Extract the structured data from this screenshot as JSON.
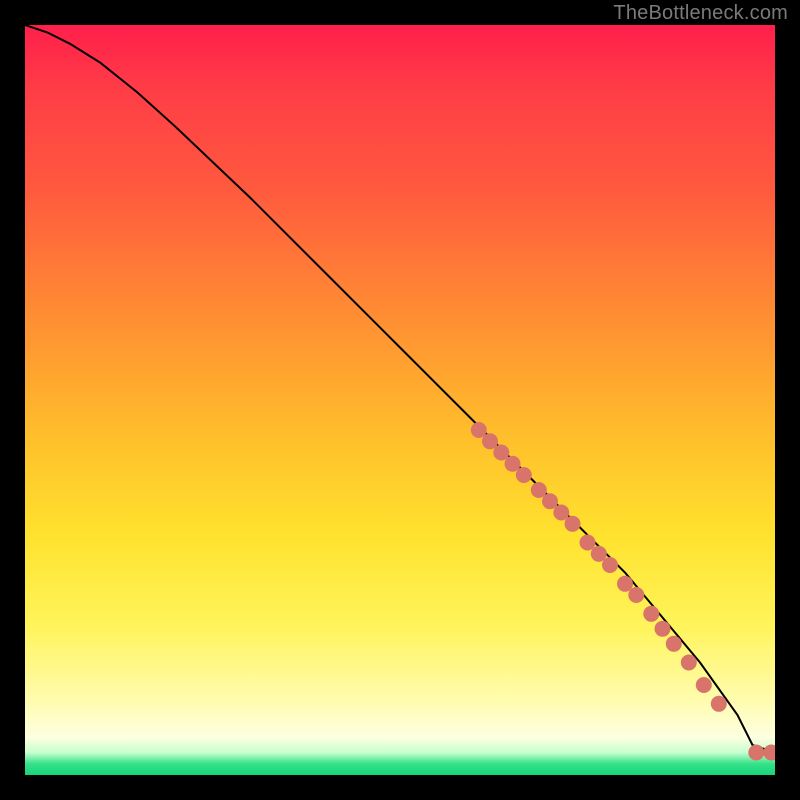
{
  "watermark": "TheBottleneck.com",
  "chart_data": {
    "type": "line",
    "title": "",
    "xlabel": "",
    "ylabel": "",
    "xlim": [
      0,
      100
    ],
    "ylim": [
      0,
      100
    ],
    "series": [
      {
        "name": "curve",
        "x": [
          0,
          3,
          6,
          10,
          15,
          20,
          30,
          40,
          50,
          60,
          70,
          80,
          90,
          95,
          97,
          100
        ],
        "y": [
          100,
          99,
          97.5,
          95,
          91,
          86.5,
          77,
          67,
          57,
          47,
          37,
          27,
          15,
          8,
          4,
          3
        ]
      }
    ],
    "scatter": {
      "name": "points",
      "color": "#d9746b",
      "radius": 8,
      "points": [
        {
          "x": 60.5,
          "y": 46.0
        },
        {
          "x": 62.0,
          "y": 44.5
        },
        {
          "x": 63.5,
          "y": 43.0
        },
        {
          "x": 65.0,
          "y": 41.5
        },
        {
          "x": 66.5,
          "y": 40.0
        },
        {
          "x": 68.5,
          "y": 38.0
        },
        {
          "x": 70.0,
          "y": 36.5
        },
        {
          "x": 71.5,
          "y": 35.0
        },
        {
          "x": 73.0,
          "y": 33.5
        },
        {
          "x": 75.0,
          "y": 31.0
        },
        {
          "x": 76.5,
          "y": 29.5
        },
        {
          "x": 78.0,
          "y": 28.0
        },
        {
          "x": 80.0,
          "y": 25.5
        },
        {
          "x": 81.5,
          "y": 24.0
        },
        {
          "x": 83.5,
          "y": 21.5
        },
        {
          "x": 85.0,
          "y": 19.5
        },
        {
          "x": 86.5,
          "y": 17.5
        },
        {
          "x": 88.5,
          "y": 15.0
        },
        {
          "x": 90.5,
          "y": 12.0
        },
        {
          "x": 92.5,
          "y": 9.5
        },
        {
          "x": 97.5,
          "y": 3.0
        },
        {
          "x": 99.5,
          "y": 3.0
        }
      ]
    },
    "gradient_stops": [
      {
        "pos": 0.0,
        "color": "#ff1f4b"
      },
      {
        "pos": 0.4,
        "color": "#ff8b33"
      },
      {
        "pos": 0.7,
        "color": "#ffe22e"
      },
      {
        "pos": 0.92,
        "color": "#fffcae"
      },
      {
        "pos": 0.985,
        "color": "#35e28a"
      },
      {
        "pos": 1.0,
        "color": "#17d57a"
      }
    ]
  }
}
